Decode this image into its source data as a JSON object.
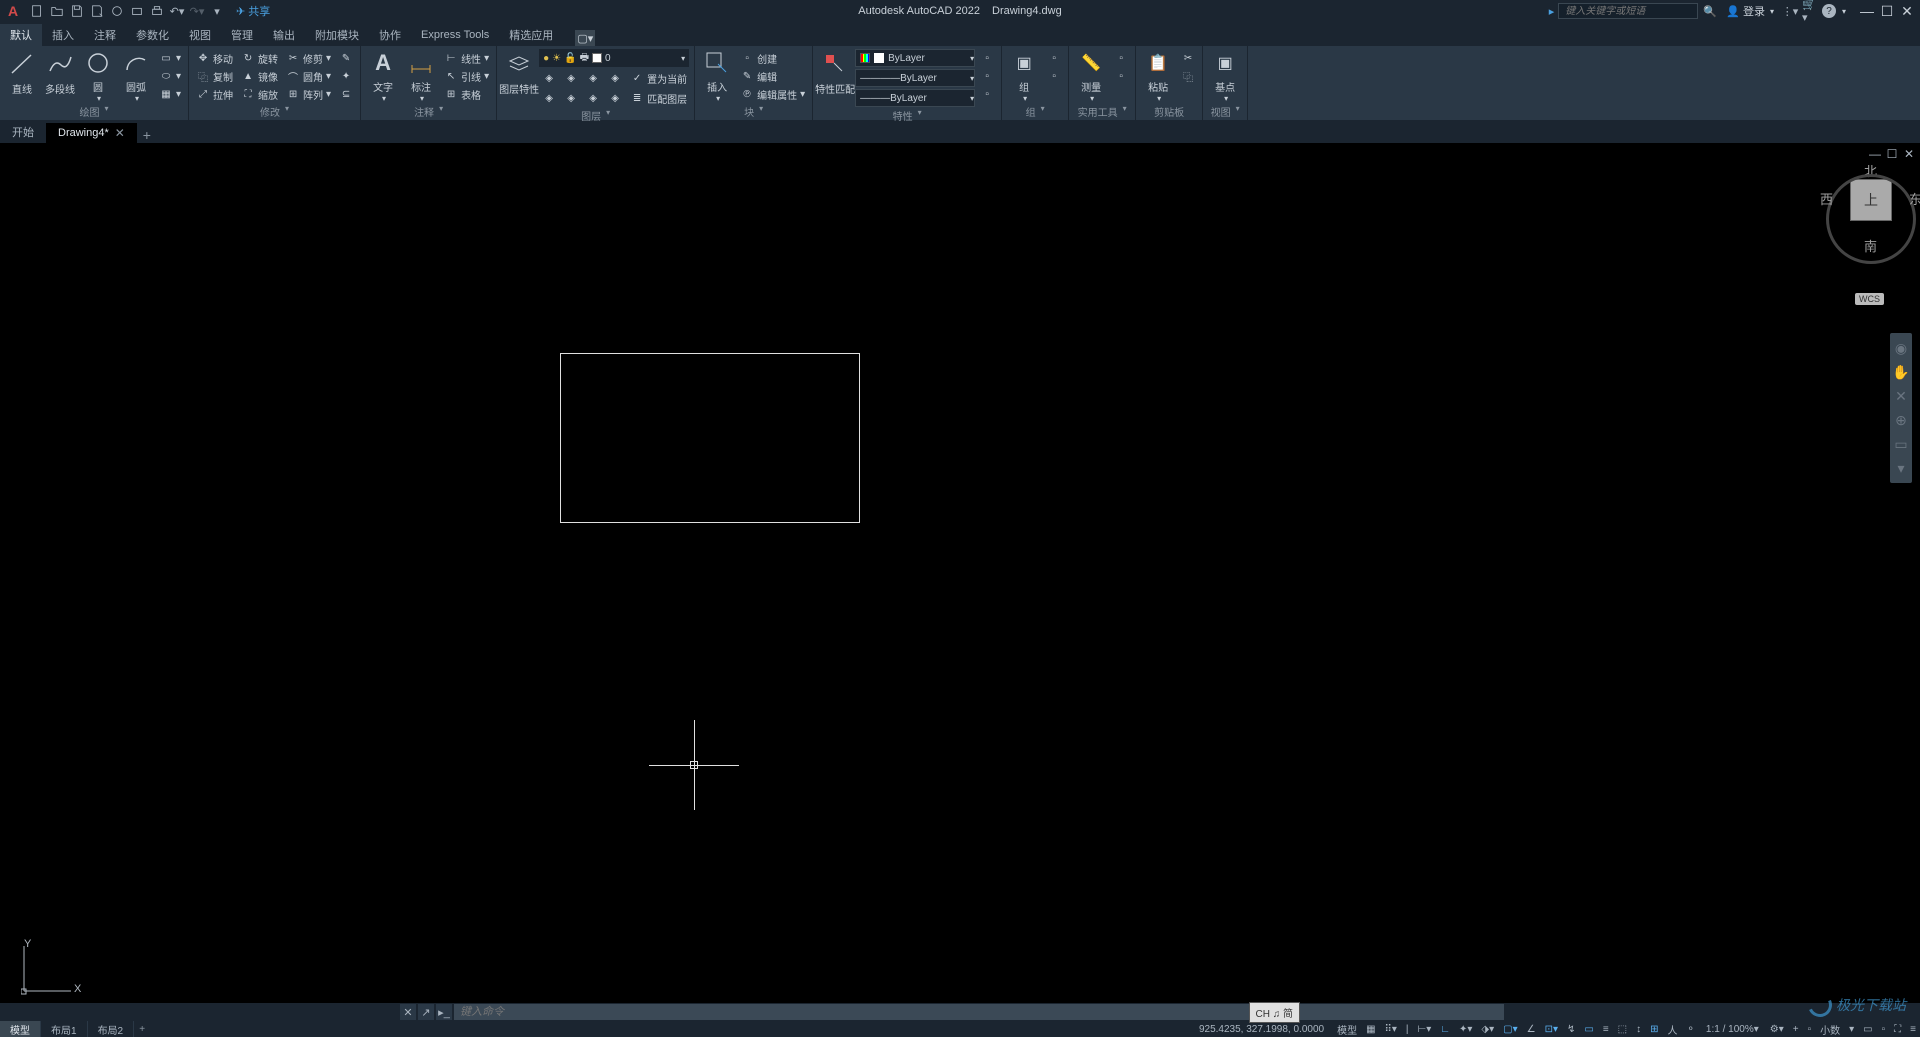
{
  "app": {
    "name": "Autodesk AutoCAD 2022",
    "filename": "Drawing4.dwg",
    "logo": "A"
  },
  "qat": {
    "share": "共享"
  },
  "title_right": {
    "search_placeholder": "键入关键字或短语",
    "login": "登录"
  },
  "menu_tabs": [
    "默认",
    "插入",
    "注释",
    "参数化",
    "视图",
    "管理",
    "输出",
    "附加模块",
    "协作",
    "Express Tools",
    "精选应用"
  ],
  "ribbon": {
    "draw": {
      "label": "绘图",
      "line": "直线",
      "polyline": "多段线",
      "circle": "圆",
      "arc": "圆弧"
    },
    "modify": {
      "label": "修改",
      "move": "移动",
      "rotate": "旋转",
      "trim": "修剪",
      "copy": "复制",
      "mirror": "镜像",
      "fillet": "圆角",
      "stretch": "拉伸",
      "scale": "缩放",
      "array": "阵列"
    },
    "annotation": {
      "label": "注释",
      "text": "文字",
      "dimension": "标注",
      "linear": "线性",
      "leader": "引线",
      "table": "表格"
    },
    "layers": {
      "label": "图层",
      "properties": "图层特性",
      "current_layer": "0",
      "set_current": "置为当前",
      "match_layer": "匹配图层"
    },
    "block": {
      "label": "块",
      "insert": "插入",
      "create": "创建",
      "edit": "编辑",
      "edit_attr": "编辑属性"
    },
    "properties": {
      "label": "特性",
      "match": "特性匹配",
      "bylayer": "ByLayer"
    },
    "group": {
      "label": "组",
      "group": "组"
    },
    "utilities": {
      "label": "实用工具",
      "measure": "测量"
    },
    "clipboard": {
      "label": "剪贴板",
      "paste": "粘贴"
    },
    "view": {
      "label": "视图",
      "base": "基点"
    }
  },
  "doc_tabs": {
    "start": "开始",
    "drawing": "Drawing4*"
  },
  "viewcube": {
    "north": "北",
    "south": "南",
    "east": "东",
    "west": "西",
    "top": "上",
    "wcs": "WCS"
  },
  "ucs": {
    "x": "X",
    "y": "Y"
  },
  "command": {
    "prompt": "键入命令"
  },
  "layout_tabs": {
    "model": "模型",
    "layout1": "布局1",
    "layout2": "布局2"
  },
  "status": {
    "coords": "925.4235, 327.1998, 0.0000",
    "model": "模型",
    "scale": "1:1 / 100%",
    "decimal": "小数"
  },
  "ime": {
    "text": "CH ♫ 简"
  },
  "watermark": {
    "text": "极光下载站"
  }
}
